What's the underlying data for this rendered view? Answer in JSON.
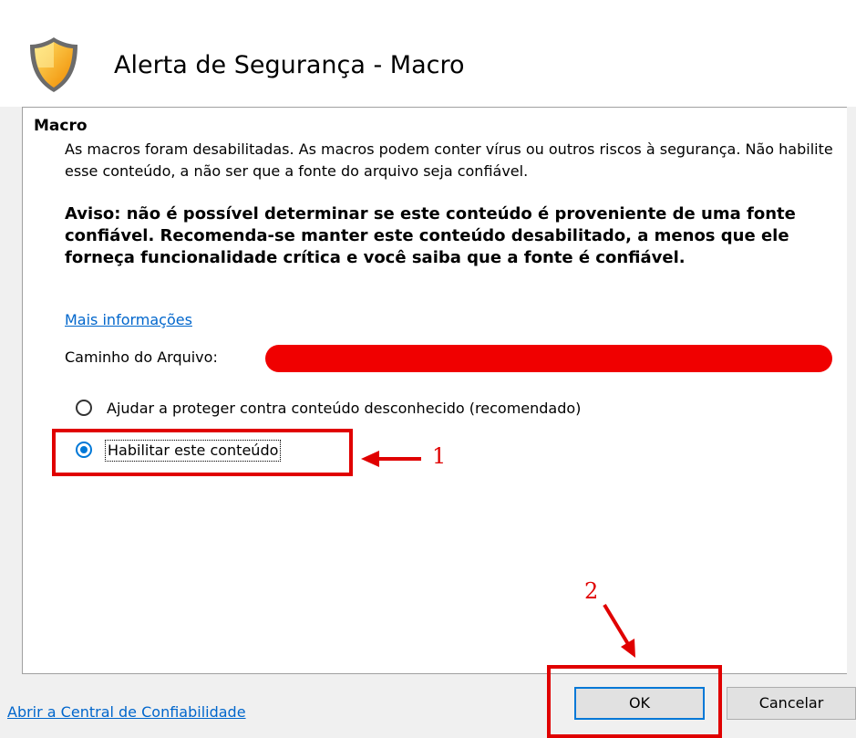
{
  "dialog": {
    "title": "Alerta de Segurança - Macro",
    "section_title": "Macro",
    "description": "As macros foram desabilitadas. As macros podem conter vírus ou outros riscos à segurança. Não habilite esse conteúdo, a não ser que a fonte do arquivo seja confiável.",
    "warning": "Aviso: não é possível determinar se este conteúdo é proveniente de uma fonte confiável. Recomenda-se manter este conteúdo desabilitado, a menos que ele forneça funcionalidade crítica e você saiba que a fonte é confiável.",
    "more_info_link": "Mais informações",
    "file_path_label": "Caminho do Arquivo:",
    "options": [
      {
        "label": "Ajudar a proteger contra conteúdo desconhecido (recomendado)",
        "selected": false
      },
      {
        "label": "Habilitar este conteúdo",
        "selected": true
      }
    ],
    "trust_center_link": "Abrir a Central de Confiabilidade",
    "ok_label": "OK",
    "cancel_label": "Cancelar"
  },
  "annotations": {
    "step1": "1",
    "step2": "2",
    "color": "#e00000"
  },
  "icons": {
    "shield": "shield-warning-icon"
  },
  "colors": {
    "accent": "#0078d7",
    "link": "#0066cc",
    "redaction": "#f00000"
  }
}
